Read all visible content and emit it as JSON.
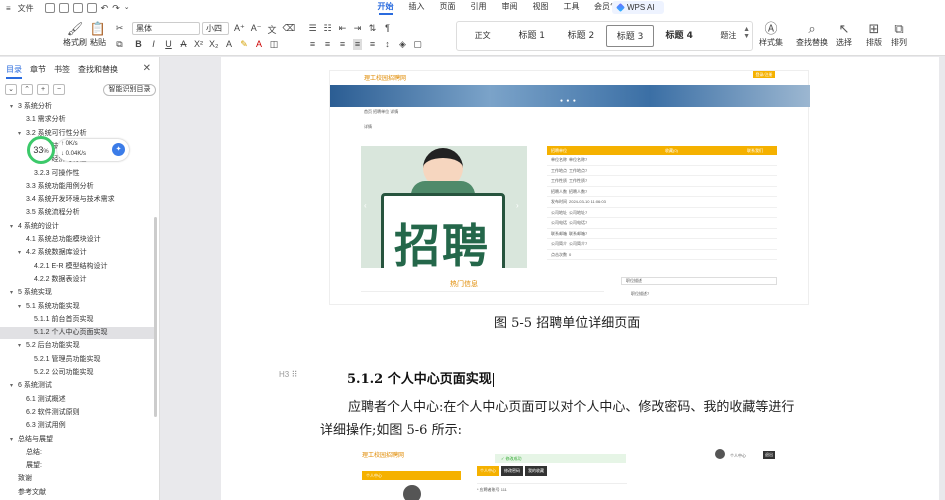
{
  "menubar": {
    "file_label": "文件",
    "tabs": [
      "开始",
      "插入",
      "页面",
      "引用",
      "审阅",
      "视图",
      "工具",
      "会员专享"
    ],
    "active_tab": "开始",
    "wps_ai": "WPS AI"
  },
  "ribbon": {
    "format_painter": "格式刷",
    "paste": "粘贴",
    "font_name": "黑体",
    "font_size": "小四",
    "styles": [
      "正文",
      "标题 1",
      "标题 2",
      "标题 3",
      "标题 4",
      "题注"
    ],
    "selected_style": "标题 3",
    "style_set": "样式集",
    "find_replace": "查找替换",
    "select": "选择",
    "layout": "排版",
    "arrange": "排列"
  },
  "panel": {
    "tabs": [
      "目录",
      "章节",
      "书签",
      "查找和替换"
    ],
    "active_tab": "目录",
    "smart_toc": "智能识别目录",
    "items": [
      {
        "text": "3 系统分析",
        "level": 0,
        "arrow": true
      },
      {
        "text": "3.1 需求分析",
        "level": 1,
        "arrow": false
      },
      {
        "text": "3.2 系统可行性分析",
        "level": 1,
        "arrow": true
      },
      {
        "text": "3.2.1 技术可行性",
        "level": 2,
        "arrow": false
      },
      {
        "text": "3.2.2 经济可行性",
        "level": 2,
        "arrow": false
      },
      {
        "text": "3.2.3 可操作性",
        "level": 2,
        "arrow": false
      },
      {
        "text": "3.3 系统功能用例分析",
        "level": 1,
        "arrow": false
      },
      {
        "text": "3.4 系统开发环境与技术需求",
        "level": 1,
        "arrow": false
      },
      {
        "text": "3.5 系统流程分析",
        "level": 1,
        "arrow": false
      },
      {
        "text": "4 系统的设计",
        "level": 0,
        "arrow": true
      },
      {
        "text": "4.1 系统总功能模块设计",
        "level": 1,
        "arrow": false
      },
      {
        "text": "4.2 系统数据库设计",
        "level": 1,
        "arrow": true
      },
      {
        "text": "4.2.1 E-R 模型结构设计",
        "level": 2,
        "arrow": false
      },
      {
        "text": "4.2.2 数据表设计",
        "level": 2,
        "arrow": false
      },
      {
        "text": "5 系统实现",
        "level": 0,
        "arrow": true
      },
      {
        "text": "5.1 系统功能实现",
        "level": 1,
        "arrow": true
      },
      {
        "text": "5.1.1 前台首页实现",
        "level": 2,
        "arrow": false
      },
      {
        "text": "5.1.2 个人中心页面实现",
        "level": 2,
        "arrow": false,
        "selected": true
      },
      {
        "text": "5.2 后台功能实现",
        "level": 1,
        "arrow": true
      },
      {
        "text": "5.2.1 管理员功能实现",
        "level": 2,
        "arrow": false
      },
      {
        "text": "5.2.2 公司功能实现",
        "level": 2,
        "arrow": false
      },
      {
        "text": "6 系统测试",
        "level": 0,
        "arrow": true
      },
      {
        "text": "6.1 测试概述",
        "level": 1,
        "arrow": false
      },
      {
        "text": "6.2 软件测试原则",
        "level": 1,
        "arrow": false
      },
      {
        "text": "6.3 测试用例",
        "level": 1,
        "arrow": false
      },
      {
        "text": "总结与展望",
        "level": 0,
        "arrow": true
      },
      {
        "text": "总结:",
        "level": 1,
        "arrow": false
      },
      {
        "text": "展望:",
        "level": 1,
        "arrow": false
      },
      {
        "text": "致谢",
        "level": 0,
        "arrow": false
      },
      {
        "text": "参考文献",
        "level": 0,
        "arrow": false
      }
    ]
  },
  "speed": {
    "percent": "33",
    "percent_unit": "%",
    "up": "0K/s",
    "down": "0.04K/s"
  },
  "doc": {
    "shot1": {
      "logo": "理工校园招聘网",
      "login": "登录/注册",
      "crumb": "首页  招聘单位  详情",
      "crumb2": "详情",
      "poster_text": "招聘",
      "table_head": [
        "招聘单位",
        "收藏(0)",
        "联系我们"
      ],
      "rows": [
        {
          "k": "单位名称",
          "v": "单位名称7"
        },
        {
          "k": "工作地点",
          "v": "工作地点7"
        },
        {
          "k": "工作性质",
          "v": "工作性质7"
        },
        {
          "k": "招聘人数",
          "v": "招聘人数7"
        },
        {
          "k": "发布时间",
          "v": "2024-03-10 11:06:03"
        },
        {
          "k": "公司地址",
          "v": "公司地址7"
        },
        {
          "k": "公司电话",
          "v": "公司电话7"
        },
        {
          "k": "联系邮箱",
          "v": "联系邮箱7"
        },
        {
          "k": "公司简介",
          "v": "公司简介7"
        },
        {
          "k": "点击次数",
          "v": "0"
        }
      ],
      "hot": "热门信息",
      "side_box": "职位描述",
      "side_text": "职位描述7"
    },
    "caption": "图 5-5 招聘单位详细页面",
    "heading_mark": "H3",
    "heading": "5.1.2 个人中心页面实现",
    "para_line1": "应聘者个人中心:在个人中心页面可以对个人中心、修改密码、我的收藏等进行",
    "para_line2": "详细操作;如图 5-6 所示:",
    "shot2": {
      "logo": "理工校园招聘网",
      "ok": "✓ 修改成功",
      "user": "个人中心",
      "exit": "退出",
      "tabs": [
        "个人中心",
        "修改密码",
        "我的收藏"
      ],
      "left_title": "个人中心",
      "field": "* 应聘者账号   111"
    }
  }
}
